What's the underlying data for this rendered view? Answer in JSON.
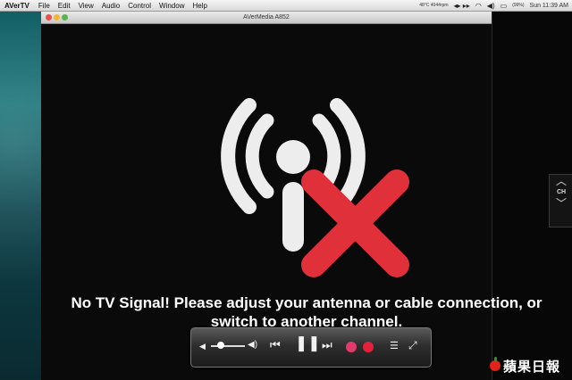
{
  "menubar": {
    "app_name": "AVerTV",
    "items": [
      "File",
      "Edit",
      "View",
      "Audio",
      "Control",
      "Window",
      "Help"
    ],
    "status_small": "48°C 4044rpm",
    "battery": "(99%)",
    "clock": "Sun 11:39 AM"
  },
  "window": {
    "title": "AVerMedia A852"
  },
  "channel_panel": {
    "label": "CH"
  },
  "main": {
    "message_line1": "No TV Signal! Please adjust your antenna or cable connection, or",
    "message_line2": "switch to another channel."
  },
  "controller": {
    "volume_level": 0.3,
    "buttons": [
      "volume-low",
      "volume-slider",
      "volume-high",
      "rewind",
      "pause",
      "fast-forward",
      "play",
      "record",
      "playlist",
      "fullscreen"
    ]
  },
  "watermark": {
    "text": "蘋果日報"
  },
  "colors": {
    "signal_cross": "#e0303a",
    "signal_arcs": "#ededed",
    "play_button": "#e23a6d",
    "record_button": "#e5203a"
  }
}
